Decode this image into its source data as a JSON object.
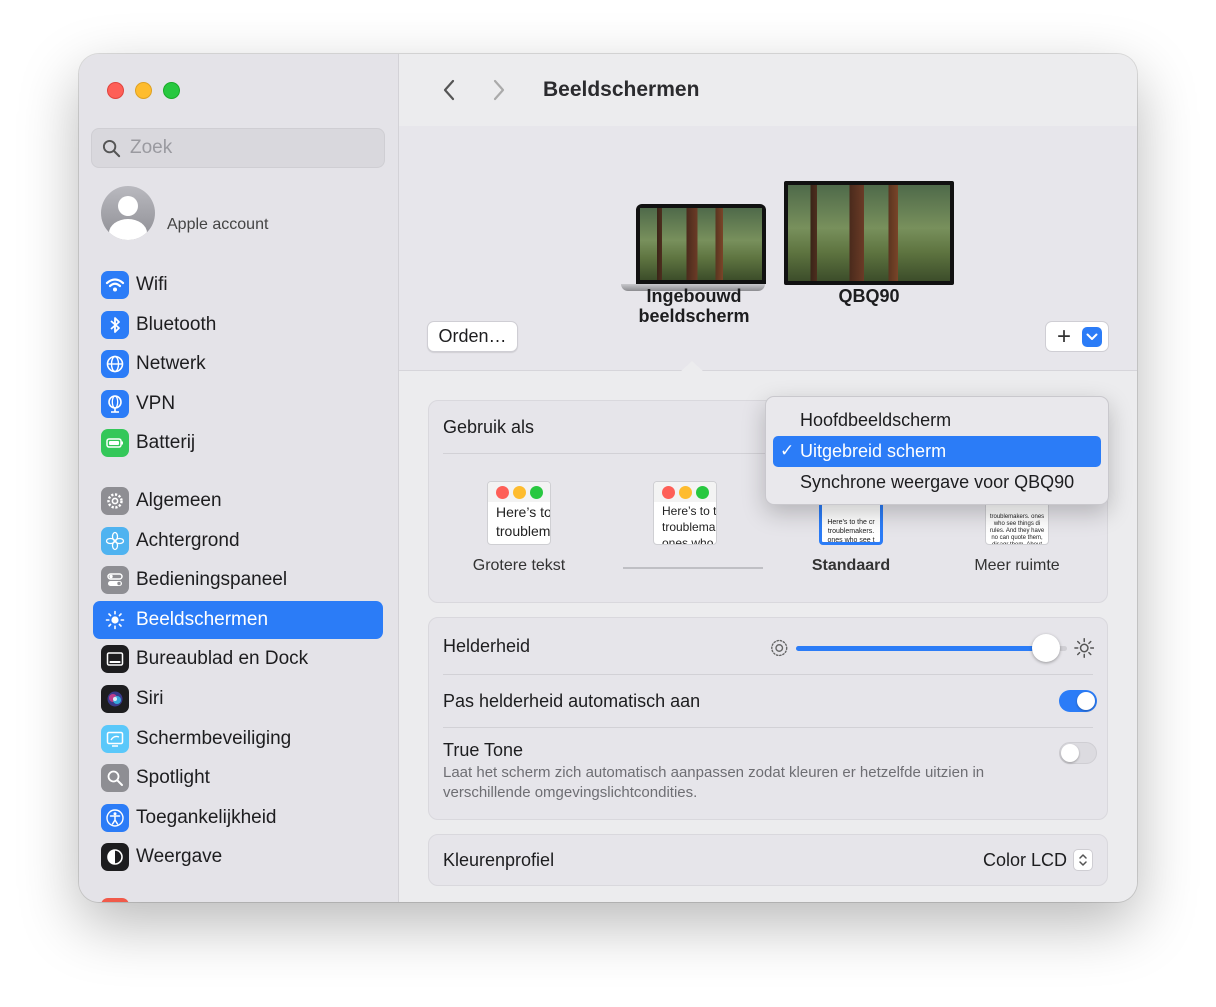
{
  "window": {
    "title": "Beeldschermen"
  },
  "sidebar": {
    "search_placeholder": "Zoek",
    "account_label": "Apple account",
    "group1": [
      {
        "label": "Wifi",
        "icon": "wifi-icon",
        "color": "#2b7cf7"
      },
      {
        "label": "Bluetooth",
        "icon": "bluetooth-icon",
        "color": "#2b7cf7"
      },
      {
        "label": "Netwerk",
        "icon": "globe-icon",
        "color": "#2b7cf7"
      },
      {
        "label": "VPN",
        "icon": "vpn-globe-icon",
        "color": "#2b7cf7"
      },
      {
        "label": "Batterij",
        "icon": "battery-icon",
        "color": "#34c759"
      }
    ],
    "group2": [
      {
        "label": "Algemeen",
        "icon": "gear-icon",
        "color": "#8e8e93"
      },
      {
        "label": "Achtergrond",
        "icon": "flower-icon",
        "color": "#4fb3f0"
      },
      {
        "label": "Bedieningspaneel",
        "icon": "switches-icon",
        "color": "#8e8e93"
      },
      {
        "label": "Beeldschermen",
        "icon": "sun-icon",
        "color": "#2b7cf7",
        "active": true
      },
      {
        "label": "Bureaublad en Dock",
        "icon": "dock-icon",
        "color": "#1d1d1f"
      },
      {
        "label": "Siri",
        "icon": "siri-icon",
        "color": "#1d1d1f"
      },
      {
        "label": "Schermbeveiliging",
        "icon": "screensaver-icon",
        "color": "#5ac8fa"
      },
      {
        "label": "Spotlight",
        "icon": "magnifier-icon",
        "color": "#8e8e93"
      },
      {
        "label": "Toegankelijkheid",
        "icon": "accessibility-icon",
        "color": "#2b7cf7"
      },
      {
        "label": "Weergave",
        "icon": "appearance-icon",
        "color": "#1d1d1f"
      }
    ]
  },
  "arrangement": {
    "arrange_label": "Orden…",
    "plus_label": "+",
    "displays": [
      {
        "name": "Ingebouwd beeldscherm",
        "line1": "Ingebouwd",
        "line2": "beeldscherm"
      },
      {
        "name": "QBQ90"
      }
    ]
  },
  "use_as": {
    "label": "Gebruik als",
    "options": [
      "Hoofdbeeldscherm",
      "Uitgebreid scherm",
      "Synchrone weergave voor QBQ90"
    ],
    "selected_index": 1
  },
  "resolution": {
    "thumb_text_large": [
      "Here’s to",
      "troublem"
    ],
    "thumb_text_medium": [
      "Here’s to t",
      "troublema",
      "ones who"
    ],
    "thumb_text_standard": "Here’s to the cr troublemakers. ones who see t rules. And they",
    "thumb_text_more": "troublemakers. ones who see things di rules. And they have no can quote them, disagr them. About the only Because they change th",
    "options": [
      {
        "label": "Grotere tekst"
      },
      {
        "label": ""
      },
      {
        "label": "Standaard",
        "selected": true
      },
      {
        "label": "Meer ruimte"
      }
    ]
  },
  "brightness": {
    "label": "Helderheid",
    "value": 0.86,
    "auto_label": "Pas helderheid automatisch aan",
    "auto_on": true,
    "true_tone_label": "True Tone",
    "true_tone_desc": "Laat het scherm zich automatisch aanpassen zodat kleuren er hetzelfde uitzien in verschillende omgevingslichtcondities.",
    "true_tone_on": false
  },
  "color_profile": {
    "label": "Kleurenprofiel",
    "value": "Color LCD"
  },
  "colors": {
    "accent": "#2b7cf7"
  }
}
